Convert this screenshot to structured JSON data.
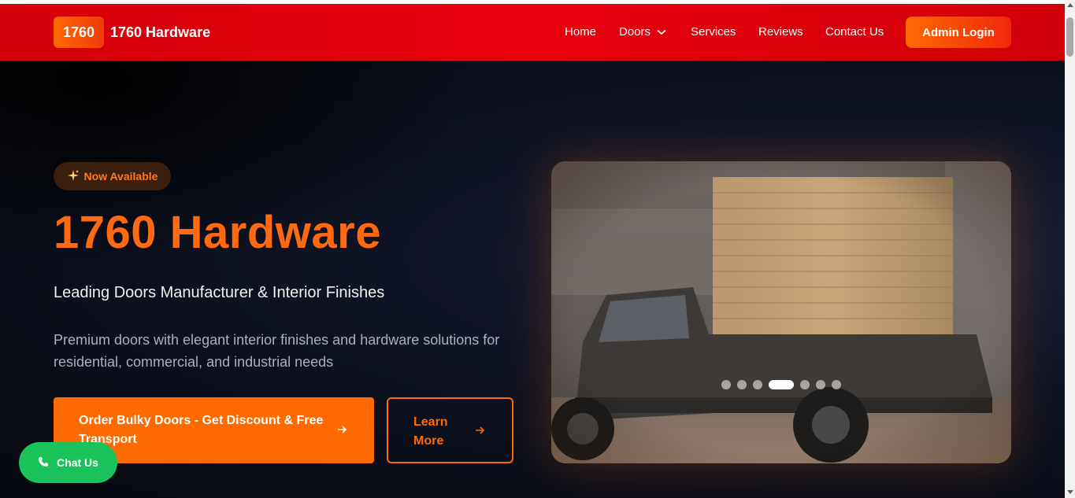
{
  "header": {
    "logo_text": "1760",
    "brand_name": "1760 Hardware",
    "nav": [
      {
        "label": "Home"
      },
      {
        "label": "Doors"
      },
      {
        "label": "Services"
      },
      {
        "label": "Reviews"
      },
      {
        "label": "Contact Us"
      }
    ],
    "admin_login": "Admin Login"
  },
  "hero": {
    "badge": "Now Available",
    "title": "1760 Hardware",
    "subtitle": "Leading Doors Manufacturer & Interior Finishes",
    "description": "Premium doors with elegant interior finishes and hardware solutions for residential, commercial, and industrial needs",
    "primary_button": "Order Bulky Doors - Get Discount & Free Transport",
    "secondary_button": "Learn More",
    "carousel": {
      "slide_count": 7,
      "active_index": 3
    }
  },
  "chat": {
    "label": "Chat Us"
  },
  "colors": {
    "accent": "#ff6a00",
    "header_red": "#e0000b",
    "chat_green": "#19c35a",
    "hero_bg": "#0b0f1a"
  },
  "icons": [
    "sparkle-icon",
    "chevron-down-icon",
    "arrow-right-icon",
    "phone-icon"
  ]
}
